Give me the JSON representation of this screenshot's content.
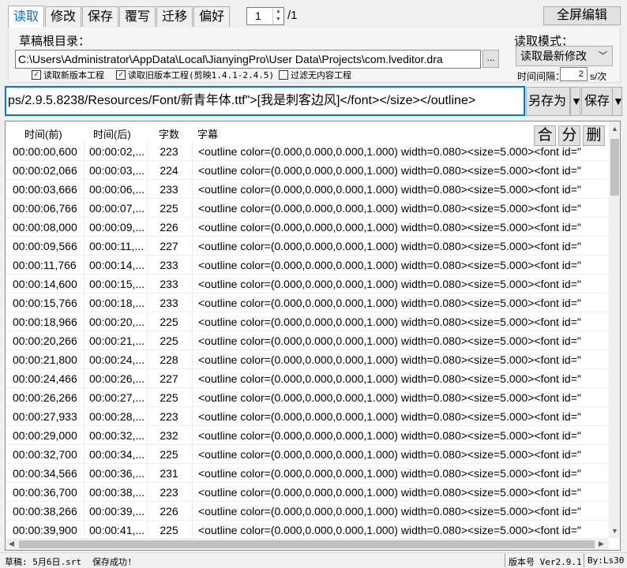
{
  "tabs": [
    {
      "label": "读取",
      "active": true
    },
    {
      "label": "修改"
    },
    {
      "label": "保存"
    },
    {
      "label": "覆写"
    },
    {
      "label": "迁移"
    },
    {
      "label": "偏好"
    }
  ],
  "page": {
    "current": "1",
    "total": "/1"
  },
  "fullscreen_label": "全屏编辑",
  "draft_root": {
    "label": "草稿根目录：",
    "path": "C:\\Users\\Administrator\\AppData\\Local\\JianyingPro\\User Data\\Projects\\com.lveditor.dra",
    "browse_label": "..."
  },
  "checkboxes": [
    {
      "label": "读取新版本工程",
      "checked": true
    },
    {
      "label": "读取旧版本工程(剪映1.4.1-2.4.5)",
      "checked": true
    },
    {
      "label": "过滤无内容工程",
      "checked": false
    }
  ],
  "read_mode": {
    "label": "读取模式：",
    "selected": "读取最新修改",
    "interval_label": "时间间隔：",
    "interval_value": "2",
    "interval_unit": "s/次"
  },
  "editor": {
    "text": "ps/2.9.5.8238/Resources/Font/新青年体.ttf\">[我是刺客边风]</font></size></outline>",
    "saveas_label": "另存为",
    "save_label": "保存"
  },
  "table": {
    "headers": [
      "时间(前)",
      "时间(后)",
      "字数",
      "字幕"
    ],
    "actions": [
      "合",
      "分",
      "删"
    ],
    "rows": [
      [
        "00:00:00,600",
        "00:00:02,...",
        "223",
        "<outline color=(0.000,0.000,0.000,1.000) width=0.080><size=5.000><font id=\""
      ],
      [
        "00:00:02,066",
        "00:00:03,...",
        "224",
        "<outline color=(0.000,0.000,0.000,1.000) width=0.080><size=5.000><font id=\""
      ],
      [
        "00:00:03,666",
        "00:00:06,...",
        "233",
        "<outline color=(0.000,0.000,0.000,1.000) width=0.080><size=5.000><font id=\""
      ],
      [
        "00:00:06,766",
        "00:00:07,...",
        "225",
        "<outline color=(0.000,0.000,0.000,1.000) width=0.080><size=5.000><font id=\""
      ],
      [
        "00:00:08,000",
        "00:00:09,...",
        "226",
        "<outline color=(0.000,0.000,0.000,1.000) width=0.080><size=5.000><font id=\""
      ],
      [
        "00:00:09,566",
        "00:00:11,...",
        "227",
        "<outline color=(0.000,0.000,0.000,1.000) width=0.080><size=5.000><font id=\""
      ],
      [
        "00:00:11,766",
        "00:00:14,...",
        "233",
        "<outline color=(0.000,0.000,0.000,1.000) width=0.080><size=5.000><font id=\""
      ],
      [
        "00:00:14,600",
        "00:00:15,...",
        "233",
        "<outline color=(0.000,0.000,0.000,1.000) width=0.080><size=5.000><font id=\""
      ],
      [
        "00:00:15,766",
        "00:00:18,...",
        "233",
        "<outline color=(0.000,0.000,0.000,1.000) width=0.080><size=5.000><font id=\""
      ],
      [
        "00:00:18,966",
        "00:00:20,...",
        "225",
        "<outline color=(0.000,0.000,0.000,1.000) width=0.080><size=5.000><font id=\""
      ],
      [
        "00:00:20,266",
        "00:00:21,...",
        "225",
        "<outline color=(0.000,0.000,0.000,1.000) width=0.080><size=5.000><font id=\""
      ],
      [
        "00:00:21,800",
        "00:00:24,...",
        "228",
        "<outline color=(0.000,0.000,0.000,1.000) width=0.080><size=5.000><font id=\""
      ],
      [
        "00:00:24,466",
        "00:00:26,...",
        "227",
        "<outline color=(0.000,0.000,0.000,1.000) width=0.080><size=5.000><font id=\""
      ],
      [
        "00:00:26,266",
        "00:00:27,...",
        "225",
        "<outline color=(0.000,0.000,0.000,1.000) width=0.080><size=5.000><font id=\""
      ],
      [
        "00:00:27,933",
        "00:00:28,...",
        "223",
        "<outline color=(0.000,0.000,0.000,1.000) width=0.080><size=5.000><font id=\""
      ],
      [
        "00:00:29,000",
        "00:00:32,...",
        "232",
        "<outline color=(0.000,0.000,0.000,1.000) width=0.080><size=5.000><font id=\""
      ],
      [
        "00:00:32,700",
        "00:00:34,...",
        "225",
        "<outline color=(0.000,0.000,0.000,1.000) width=0.080><size=5.000><font id=\""
      ],
      [
        "00:00:34,566",
        "00:00:36,...",
        "231",
        "<outline color=(0.000,0.000,0.000,1.000) width=0.080><size=5.000><font id=\""
      ],
      [
        "00:00:36,700",
        "00:00:38,...",
        "223",
        "<outline color=(0.000,0.000,0.000,1.000) width=0.080><size=5.000><font id=\""
      ],
      [
        "00:00:38,266",
        "00:00:39,...",
        "226",
        "<outline color=(0.000,0.000,0.000,1.000) width=0.080><size=5.000><font id=\""
      ],
      [
        "00:00:39,900",
        "00:00:41,...",
        "225",
        "<outline color=(0.000,0.000,0.000,1.000) width=0.080><size=5.000><font id=\""
      ]
    ]
  },
  "status": {
    "draft": "草稿: 5月6日.srt",
    "message": "保存成功!",
    "version": "版本号 Ver2.9.1",
    "author": "By:Ls30"
  },
  "colors": {
    "accent": "#0078d7",
    "active_tab_text": "#0b6fc8"
  }
}
